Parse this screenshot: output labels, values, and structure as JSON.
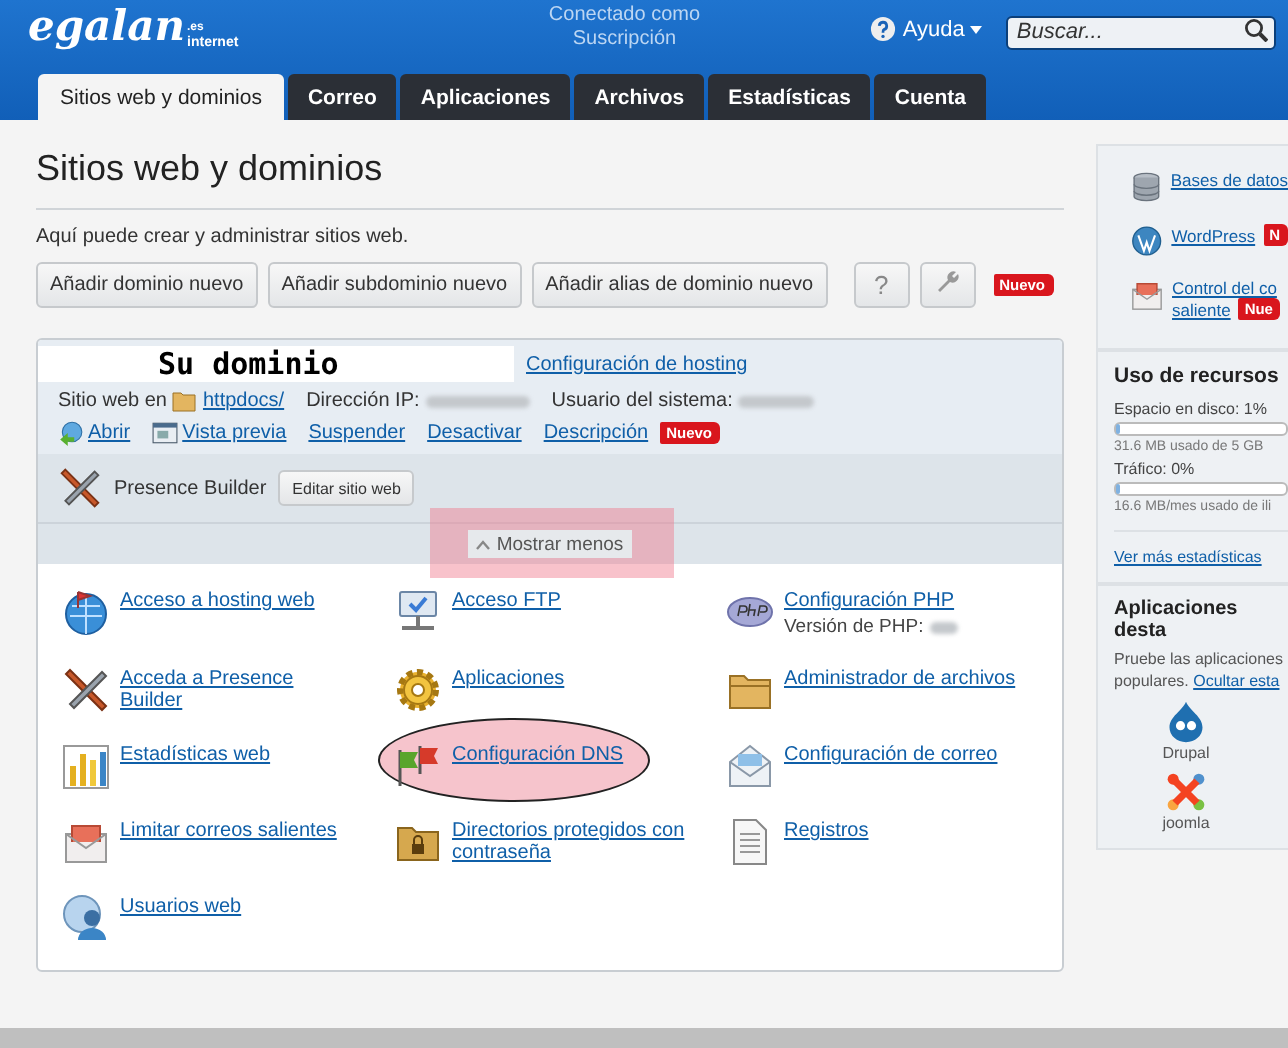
{
  "header": {
    "logo": {
      "name": "egalan",
      "suffix": ".es",
      "tagline": "internet"
    },
    "connected_label": "Conectado como",
    "subscription_label": "Suscripción",
    "help": "Ayuda",
    "search": {
      "placeholder": "Buscar..."
    }
  },
  "tabs": [
    {
      "label": "Sitios web y dominios",
      "selected": true
    },
    {
      "label": "Correo",
      "selected": false
    },
    {
      "label": "Aplicaciones",
      "selected": false
    },
    {
      "label": "Archivos",
      "selected": false
    },
    {
      "label": "Estadísticas",
      "selected": false
    },
    {
      "label": "Cuenta",
      "selected": false
    }
  ],
  "page": {
    "title": "Sitios web y dominios",
    "description": "Aquí puede crear y administrar sitios web.",
    "buttons": [
      {
        "kind": "text",
        "label": "Añadir dominio nuevo"
      },
      {
        "kind": "text",
        "label": "Añadir subdominio nuevo"
      },
      {
        "kind": "text",
        "label": "Añadir alias de dominio nuevo"
      },
      {
        "kind": "help",
        "label": "?"
      },
      {
        "kind": "tools"
      }
    ],
    "new_badge": "Nuevo"
  },
  "domain": {
    "annotation": "Su dominio",
    "hosting_link": "Configuración de hosting",
    "site_label": "Sitio web en",
    "docroot": "httpdocs/",
    "ip_label": "Dirección IP:",
    "user_label": "Usuario del sistema:",
    "actions": [
      {
        "label": "Abrir"
      },
      {
        "label": "Vista previa"
      },
      {
        "label": "Suspender"
      },
      {
        "label": "Desactivar"
      },
      {
        "label": "Descripción",
        "badge": "Nuevo"
      }
    ],
    "builder": {
      "label": "Presence Builder",
      "button": "Editar sitio web"
    },
    "toggle": {
      "label": "Mostrar menos",
      "expanded": true,
      "highlighted": true
    },
    "tools": [
      {
        "label": "Acceso a hosting web",
        "highlighted": false
      },
      {
        "label": "Acceso FTP",
        "highlighted": false
      },
      {
        "label": "Configuración PHP",
        "note": "Versión de PHP:",
        "highlighted": false
      },
      {
        "label": "Acceda a Presence Builder",
        "highlighted": false
      },
      {
        "label": "Aplicaciones",
        "highlighted": false
      },
      {
        "label": "Administrador de archivos",
        "highlighted": false
      },
      {
        "label": "Estadísticas web",
        "highlighted": false
      },
      {
        "label": "Configuración DNS",
        "highlighted": true
      },
      {
        "label": "Configuración de correo",
        "highlighted": false
      },
      {
        "label": "Limitar correos salientes",
        "highlighted": false
      },
      {
        "label": "Directorios protegidos con contraseña",
        "highlighted": false
      },
      {
        "label": "Registros",
        "highlighted": false
      },
      {
        "label": "Usuarios web",
        "highlighted": false
      }
    ]
  },
  "sidebar": {
    "links": [
      {
        "lines": [
          "Bases de datos"
        ]
      },
      {
        "lines": [
          "WordPress"
        ],
        "badge": "N"
      },
      {
        "lines": [
          "Control del co",
          "saliente"
        ],
        "badge": "Nue"
      }
    ],
    "resources": {
      "title": "Uso de recursos",
      "meters": [
        {
          "label": "Espacio en disco: 1%",
          "level": 0.01,
          "reading": "31.6 MB usado de 5 GB"
        },
        {
          "label": "Tráfico: 0%",
          "level": 0,
          "reading": "16.6 MB/mes usado de ili"
        }
      ],
      "more_link": "Ver más estadísticas"
    },
    "apps": {
      "title": "Aplicaciones desta",
      "description": "Pruebe las aplicaciones populares.",
      "hide_link": "Ocultar esta",
      "items": [
        {
          "name": "Drupal"
        },
        {
          "name": "joomla"
        }
      ]
    }
  }
}
